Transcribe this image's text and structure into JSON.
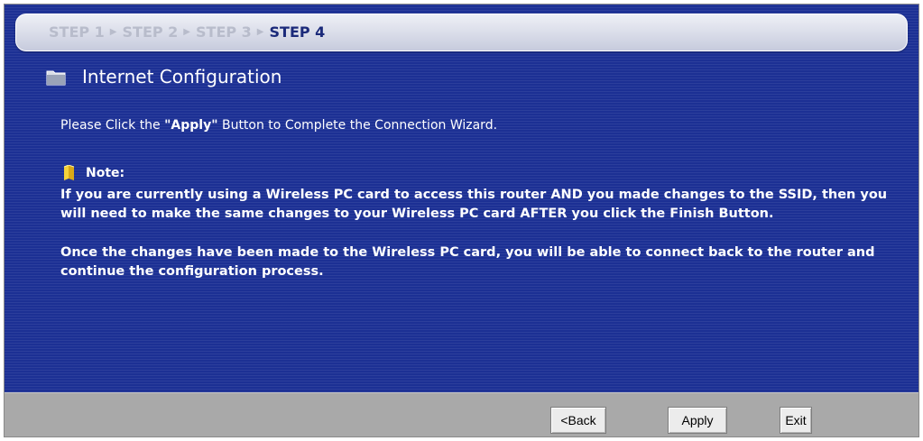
{
  "steps": {
    "items": [
      "STEP 1",
      "STEP 2",
      "STEP 3",
      "STEP 4"
    ],
    "current_index": 3
  },
  "header": {
    "title": "Internet Configuration",
    "icon": "folder-icon"
  },
  "instruction": {
    "prefix": "Please Click the ",
    "highlight": "\"Apply\"",
    "suffix": " Button to Complete the Connection Wizard."
  },
  "note": {
    "label": "Note:",
    "icon": "note-icon",
    "paragraph1": "If you are currently using a Wireless PC card to access this router AND you made changes to the SSID, then you will need to make the same changes to your Wireless PC card AFTER you click the Finish Button.",
    "paragraph2": "Once the changes have been made to the Wireless PC card, you will be able to connect back to the router and continue the configuration process."
  },
  "buttons": {
    "back": "<Back",
    "apply": "Apply",
    "exit": "Exit"
  },
  "colors": {
    "background": "#1c3094",
    "bottom_bar": "#a9a9a9",
    "current_step": "#1b2a7a",
    "inactive_step": "#b8bccb"
  }
}
